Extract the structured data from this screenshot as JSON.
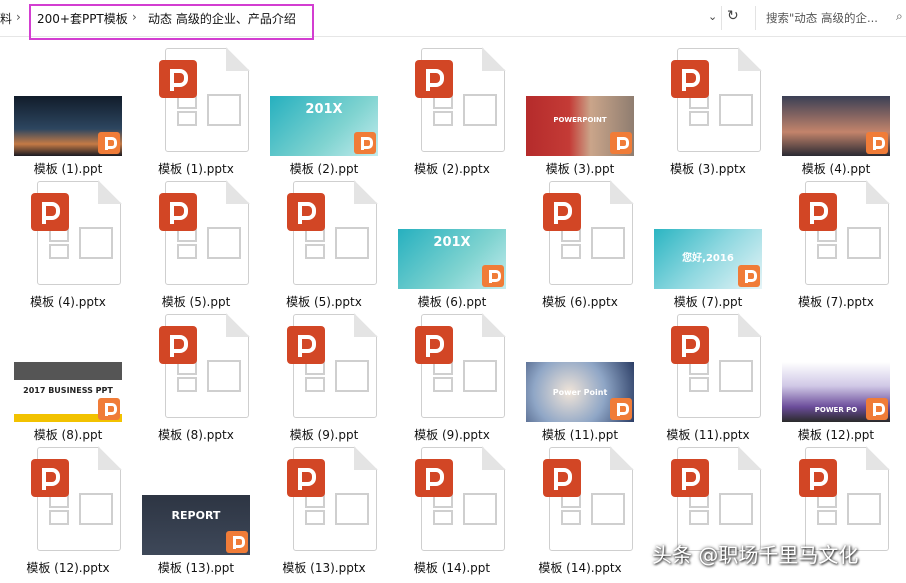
{
  "address": {
    "left_fragment": "料",
    "crumbs": [
      "200+套PPT模板",
      "动态 高级的企业、产品介绍"
    ],
    "separator": "›",
    "dropdown": "⌄",
    "refresh": "↻"
  },
  "search": {
    "placeholder": "搜索\"动态 高级的企...",
    "icon": "search-icon"
  },
  "files": [
    {
      "name": "模板 (1).ppt",
      "kind": "ppt"
    },
    {
      "name": "模板 (1).pptx",
      "kind": "pptx"
    },
    {
      "name": "模板 (2).ppt",
      "kind": "ppt",
      "thumb_title": "201X"
    },
    {
      "name": "模板 (2).pptx",
      "kind": "pptx"
    },
    {
      "name": "模板 (3).ppt",
      "kind": "ppt",
      "thumb_title": "POWERPOINT"
    },
    {
      "name": "模板 (3).pptx",
      "kind": "pptx"
    },
    {
      "name": "模板 (4).ppt",
      "kind": "ppt"
    },
    {
      "name": "模板 (4).pptx",
      "kind": "pptx"
    },
    {
      "name": "模板 (5).ppt",
      "kind": "pptx"
    },
    {
      "name": "模板 (5).pptx",
      "kind": "pptx"
    },
    {
      "name": "模板 (6).ppt",
      "kind": "ppt",
      "thumb_title": "201X"
    },
    {
      "name": "模板 (6).pptx",
      "kind": "pptx"
    },
    {
      "name": "模板 (7).ppt",
      "kind": "ppt",
      "thumb_title": "您好,2016"
    },
    {
      "name": "模板 (7).pptx",
      "kind": "pptx"
    },
    {
      "name": "模板 (8).ppt",
      "kind": "ppt",
      "thumb_title": "2017 BUSINESS PPT"
    },
    {
      "name": "模板 (8).pptx",
      "kind": "pptx"
    },
    {
      "name": "模板 (9).ppt",
      "kind": "pptx"
    },
    {
      "name": "模板 (9).pptx",
      "kind": "pptx"
    },
    {
      "name": "模板 (11).ppt",
      "kind": "ppt",
      "thumb_title": "Power Point"
    },
    {
      "name": "模板 (11).pptx",
      "kind": "pptx"
    },
    {
      "name": "模板 (12).ppt",
      "kind": "ppt",
      "thumb_title": "POWER PO"
    },
    {
      "name": "模板 (12).pptx",
      "kind": "pptx"
    },
    {
      "name": "模板 (13).ppt",
      "kind": "ppt",
      "thumb_title": "REPORT"
    },
    {
      "name": "模板 (13).pptx",
      "kind": "pptx"
    },
    {
      "name": "模板 (14).ppt",
      "kind": "pptx"
    },
    {
      "name": "模板 (14).pptx",
      "kind": "pptx"
    },
    {
      "name": "",
      "kind": "pptx"
    },
    {
      "name": "",
      "kind": "pptx"
    }
  ],
  "watermark": "头条 @职场千里马文化",
  "colors": {
    "highlight_border": "#d33ed1",
    "ppt_badge": "#d24625",
    "ppt_mini_badge": "#f07c38"
  }
}
